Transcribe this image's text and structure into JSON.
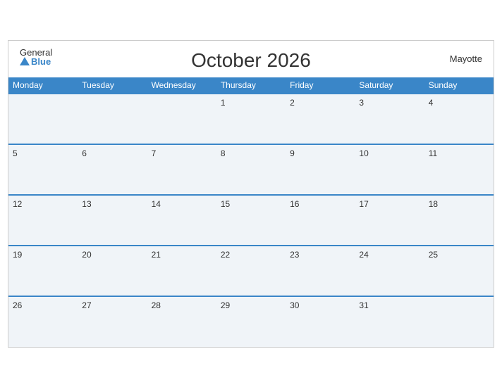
{
  "logo": {
    "general": "General",
    "blue": "Blue"
  },
  "header": {
    "title": "October 2026",
    "region": "Mayotte"
  },
  "weekdays": [
    "Monday",
    "Tuesday",
    "Wednesday",
    "Thursday",
    "Friday",
    "Saturday",
    "Sunday"
  ],
  "weeks": [
    [
      null,
      null,
      null,
      1,
      2,
      3,
      4
    ],
    [
      5,
      6,
      7,
      8,
      9,
      10,
      11
    ],
    [
      12,
      13,
      14,
      15,
      16,
      17,
      18
    ],
    [
      19,
      20,
      21,
      22,
      23,
      24,
      25
    ],
    [
      26,
      27,
      28,
      29,
      30,
      31,
      null
    ]
  ]
}
